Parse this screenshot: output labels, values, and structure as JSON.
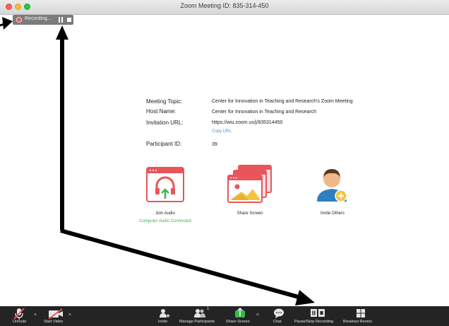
{
  "window": {
    "title": "Zoom Meeting ID: 835-314-450"
  },
  "recording_bar": {
    "label": "Recording..."
  },
  "meeting": {
    "topic_label": "Meeting Topic:",
    "topic_value": "Center for Innovation in Teaching and Research's Zoom Meeting",
    "host_label": "Host Name:",
    "host_value": "Center for Innovation in Teaching and Research",
    "url_label": "Invitation URL:",
    "url_value": "https://wiu.zoom.us/j/835314450",
    "copy_url": "Copy URL",
    "participant_label": "Participant ID:",
    "participant_value": "39"
  },
  "tiles": {
    "join_audio": {
      "label": "Join Audio",
      "sub": "Computer Audio Connected"
    },
    "share_screen": {
      "label": "Share Screen"
    },
    "invite_others": {
      "label": "Invite Others"
    }
  },
  "toolbar": {
    "unmute": "Unmute",
    "start_video": "Start Video",
    "invite": "Invite",
    "manage_participants": "Manage Participants",
    "participants_count": "1",
    "share_screen": "Share Screen",
    "chat": "Chat",
    "pause_stop_recording": "Pause/Stop Recording",
    "breakout_rooms": "Breakout Rooms"
  },
  "colors": {
    "accent_red": "#e8555a",
    "connected_green": "#3cb54a",
    "link_blue": "#4a90d9",
    "toolbar_bg": "#242424"
  }
}
